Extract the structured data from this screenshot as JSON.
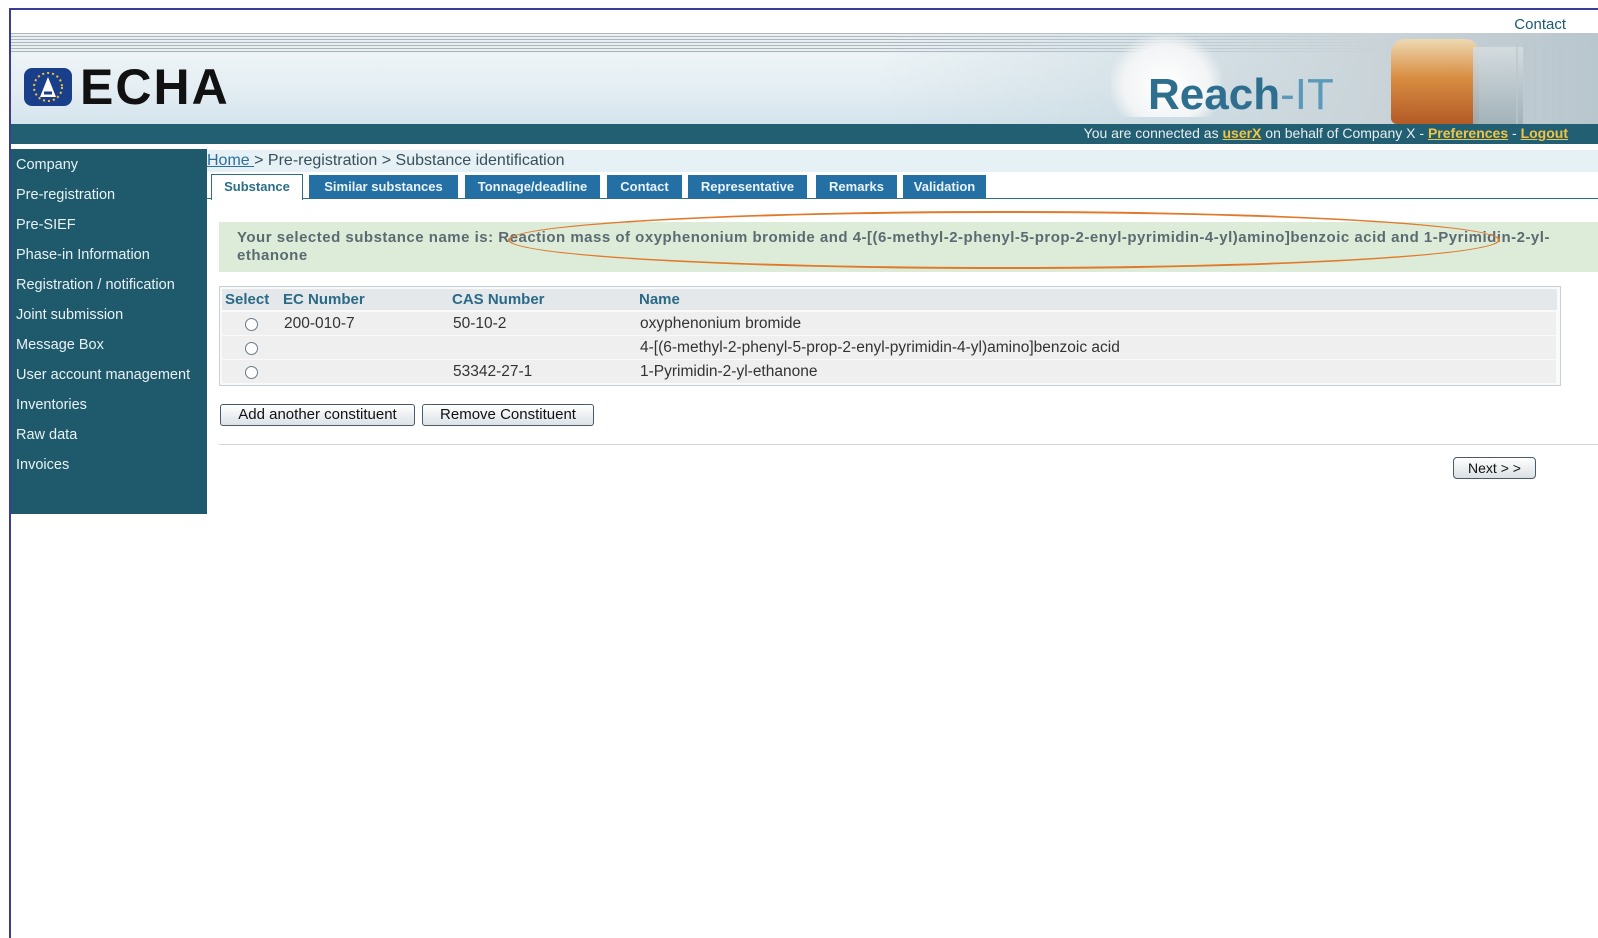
{
  "header": {
    "contact_link": "Contact",
    "logo_text": "ECHA",
    "app_name_main": "Reach",
    "app_name_suffix": "-IT"
  },
  "connection": {
    "prefix": "You are connected as ",
    "user": "userX",
    "middle": " on behalf of Company X - ",
    "preferences": "Preferences",
    "separator": " - ",
    "logout": "Logout"
  },
  "sidebar": {
    "items": [
      {
        "label": "Company"
      },
      {
        "label": "Pre-registration"
      },
      {
        "label": "Pre-SIEF"
      },
      {
        "label": "Phase-in Information"
      },
      {
        "label": "Registration / notification"
      },
      {
        "label": "Joint submission"
      },
      {
        "label": "Message Box"
      },
      {
        "label": "User account management"
      },
      {
        "label": "Inventories"
      },
      {
        "label": "Raw data"
      },
      {
        "label": "Invoices"
      }
    ]
  },
  "breadcrumb": {
    "home": "Home ",
    "rest": "> Pre-registration > Substance identification"
  },
  "tabs": [
    {
      "label": "Substance",
      "active": true
    },
    {
      "label": "Similar substances"
    },
    {
      "label": "Tonnage/deadline"
    },
    {
      "label": "Contact"
    },
    {
      "label": "Representative"
    },
    {
      "label": "Remarks"
    },
    {
      "label": "Validation"
    }
  ],
  "notice": {
    "text": "Your selected substance name is: Reaction mass of oxyphenonium bromide and 4-[(6-methyl-2-phenyl-5-prop-2-enyl-pyrimidin-4-yl)amino]benzoic acid and 1-Pyrimidin-2-yl-ethanone"
  },
  "table": {
    "headers": [
      "Select",
      "EC Number",
      "CAS Number",
      "Name"
    ],
    "rows": [
      {
        "ec": "200-010-7",
        "cas": "50-10-2",
        "name": "oxyphenonium bromide"
      },
      {
        "ec": "",
        "cas": "",
        "name": "4-[(6-methyl-2-phenyl-5-prop-2-enyl-pyrimidin-4-yl)amino]benzoic acid"
      },
      {
        "ec": "",
        "cas": "53342-27-1",
        "name": "1-Pyrimidin-2-yl-ethanone"
      }
    ]
  },
  "buttons": {
    "add": "Add another constituent",
    "remove": "Remove Constituent",
    "next": "Next > >"
  },
  "colors": {
    "sidebar": "#1e5a6c",
    "tab": "#2470a5",
    "highlight_oval": "#e07a2a",
    "notice_bg": "#ddecd8"
  }
}
